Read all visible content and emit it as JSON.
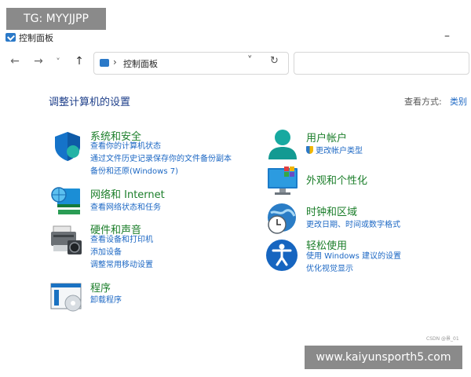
{
  "window": {
    "title": "控制面板"
  },
  "nav": {
    "back_icon": "arrow-left-icon",
    "forward_icon": "arrow-right-icon",
    "recent_icon": "chevron-down-icon",
    "up_icon": "arrow-up-icon",
    "back": "←",
    "forward": "→",
    "recent": "˅",
    "up": "↑"
  },
  "address": {
    "separator": "›",
    "path": "控制面板",
    "dropdown": "˅",
    "refresh": "↻"
  },
  "content": {
    "heading": "调整计算机的设置",
    "view_by_label": "查看方式:",
    "view_by_value": "类别"
  },
  "categories": {
    "system_security": {
      "title": "系统和安全",
      "links": [
        "查看你的计算机状态",
        "通过文件历史记录保存你的文件备份副本",
        "备份和还原(Windows 7)"
      ]
    },
    "network": {
      "title": "网络和 Internet",
      "links": [
        "查看网络状态和任务"
      ]
    },
    "hardware": {
      "title": "硬件和声音",
      "links": [
        "查看设备和打印机",
        "添加设备",
        "调整常用移动设置"
      ]
    },
    "programs": {
      "title": "程序",
      "links": [
        "卸载程序"
      ]
    },
    "user_accounts": {
      "title": "用户帐户",
      "links": [
        "更改帐户类型"
      ]
    },
    "appearance": {
      "title": "外观和个性化",
      "links": []
    },
    "clock_region": {
      "title": "时钟和区域",
      "links": [
        "更改日期、时间或数字格式"
      ]
    },
    "ease_access": {
      "title": "轻松使用",
      "links": [
        "使用 Windows 建议的设置",
        "优化视觉显示"
      ]
    }
  },
  "watermarks": {
    "top_left": "TG: MYYJJPP",
    "bottom_right": "www.kaiyunsporth5.com",
    "csdn": "CSDN @景_01"
  },
  "colors": {
    "category_title": "#1b7e2a",
    "link": "#1d68c4",
    "heading": "#1e3f8a",
    "watermark_bg": "#8a8a8a"
  }
}
